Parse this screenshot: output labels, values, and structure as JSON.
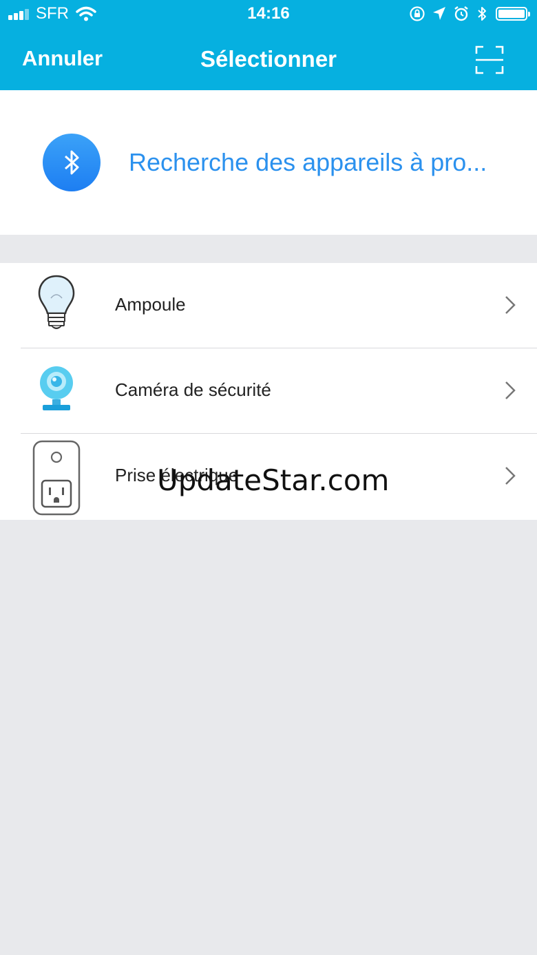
{
  "status_bar": {
    "carrier": "SFR",
    "time": "14:16"
  },
  "nav": {
    "cancel_label": "Annuler",
    "title": "Sélectionner"
  },
  "bluetooth_search": {
    "text": "Recherche des appareils à pro..."
  },
  "devices": [
    {
      "label": "Ampoule",
      "icon": "bulb-icon"
    },
    {
      "label": "Caméra de sécurité",
      "icon": "camera-icon"
    },
    {
      "label": "Prise électrique",
      "icon": "plug-icon"
    }
  ],
  "watermark": "UpdateStar.com",
  "colors": {
    "header": "#06b0e0",
    "accent_blue": "#2b91ee",
    "background": "#e8e9ec"
  }
}
